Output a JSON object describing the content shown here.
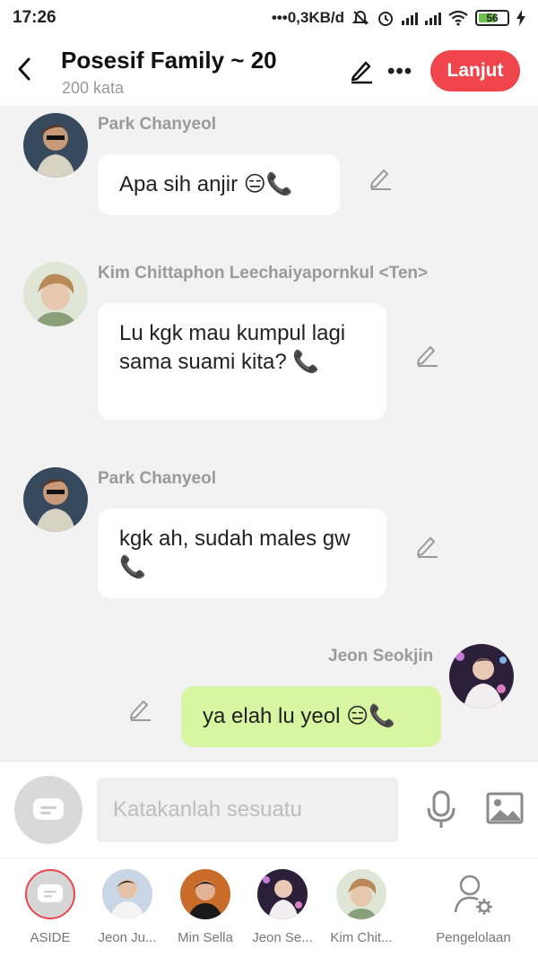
{
  "status_bar": {
    "time": "17:26",
    "network_speed": "0,3KB/d",
    "battery": "56"
  },
  "header": {
    "title": "Posesif Family ~ 20",
    "subtitle": "200 kata",
    "next_label": "Lanjut"
  },
  "messages": [
    {
      "sender": "Park Chanyeol",
      "text": "Apa sih anjir 😑📞",
      "mine": false
    },
    {
      "sender": "Kim Chittaphon Leechaiyapornkul <Ten>",
      "text": "Lu kgk mau kumpul lagi sama suami kita? 📞",
      "mine": false
    },
    {
      "sender": "Park Chanyeol",
      "text": "kgk ah, sudah males gw 📞",
      "mine": false
    },
    {
      "sender": "Jeon Seokjin",
      "text": "ya elah lu yeol 😑📞",
      "mine": true
    }
  ],
  "input": {
    "placeholder": "Katakanlah sesuatu"
  },
  "roster": [
    {
      "label": "ASIDE"
    },
    {
      "label": "Jeon Ju..."
    },
    {
      "label": "Min Sella"
    },
    {
      "label": "Jeon Se..."
    },
    {
      "label": "Kim Chit..."
    },
    {
      "label": "Pengelolaan"
    }
  ],
  "colors": {
    "accent": "#f0454c",
    "my_bubble": "#d8f5a2",
    "background": "#f2f2f2"
  }
}
